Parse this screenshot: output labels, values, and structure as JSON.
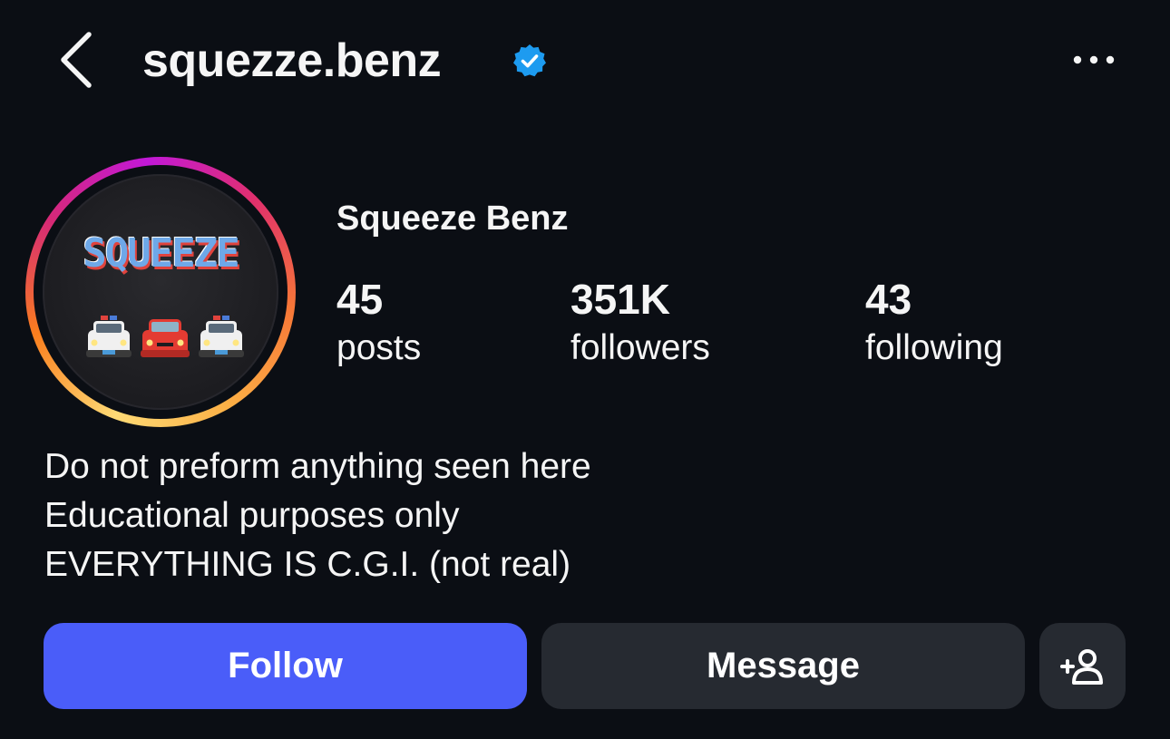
{
  "header": {
    "username": "squezze.benz",
    "verified_icon": "verified-badge-icon",
    "back_icon": "chevron-left-icon",
    "more_icon": "more-options-icon"
  },
  "profile": {
    "display_name": "Squeeze Benz",
    "avatar_text": "SQUEEZE",
    "stats": [
      {
        "value": "45",
        "label": "posts"
      },
      {
        "value": "351K",
        "label": "followers"
      },
      {
        "value": "43",
        "label": "following"
      }
    ],
    "bio": [
      "Do not preform anything seen here",
      "Educational purposes only",
      "EVERYTHING IS C.G.I. (not real)"
    ]
  },
  "actions": {
    "follow_label": "Follow",
    "message_label": "Message",
    "add_person_icon": "add-person-icon"
  },
  "colors": {
    "background": "#0b0e14",
    "follow_button": "#4a5df9",
    "secondary_button": "#262a31",
    "verified_blue": "#1d9bf0"
  }
}
